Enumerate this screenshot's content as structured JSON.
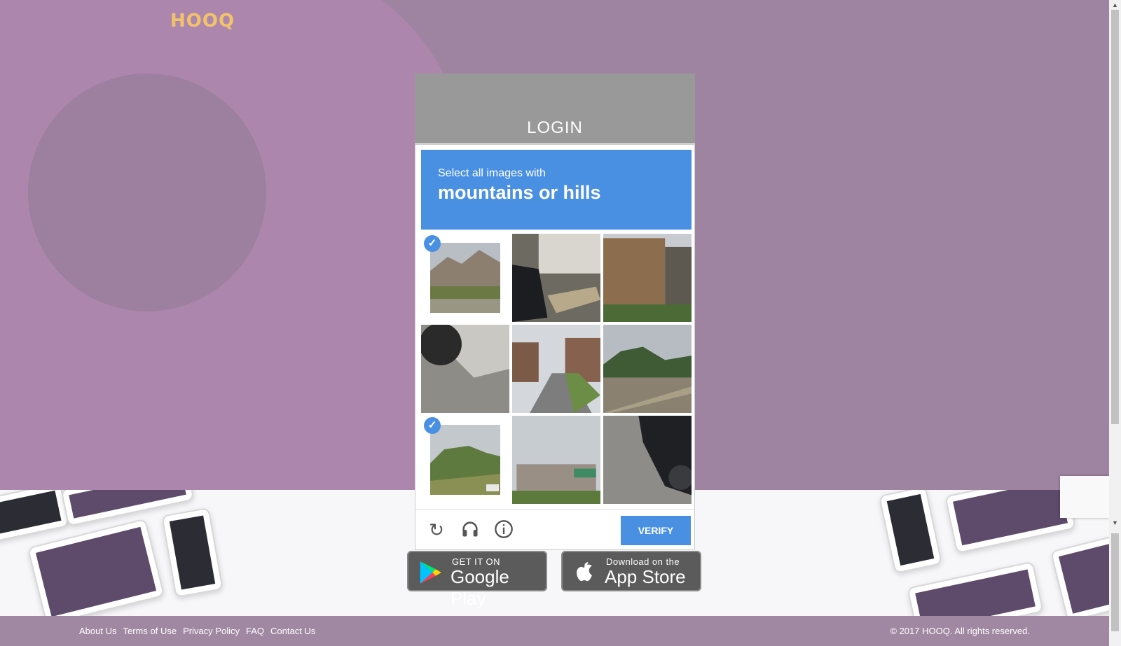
{
  "brand": {
    "logo": "HOOQ",
    "logo_color": "#f2c46a"
  },
  "login": {
    "title": "LOGIN"
  },
  "captcha": {
    "instruction_small": "Select all images with",
    "instruction_target": "mountains or hills",
    "verify_label": "VERIFY",
    "accent": "#4a90e2",
    "tiles": [
      {
        "selected": true,
        "scene": "mountain-valley"
      },
      {
        "selected": false,
        "scene": "car-driveway"
      },
      {
        "selected": false,
        "scene": "apartment-building"
      },
      {
        "selected": false,
        "scene": "car-wheel-road"
      },
      {
        "selected": false,
        "scene": "street-intersection"
      },
      {
        "selected": false,
        "scene": "hillside-railway"
      },
      {
        "selected": true,
        "scene": "grassy-hill"
      },
      {
        "selected": false,
        "scene": "storefront-street"
      },
      {
        "selected": false,
        "scene": "car-side-pavement"
      }
    ],
    "icons": [
      "reload-icon",
      "audio-icon",
      "info-icon"
    ]
  },
  "stores": {
    "google": {
      "small": "GET IT ON",
      "big": "Google Play"
    },
    "apple": {
      "small": "Download on the",
      "big": "App Store"
    }
  },
  "footer": {
    "links": [
      "About Us",
      "Terms of Use",
      "Privacy Policy",
      "FAQ",
      "Contact Us"
    ],
    "copyright": "© 2017 HOOQ. All rights reserved."
  }
}
